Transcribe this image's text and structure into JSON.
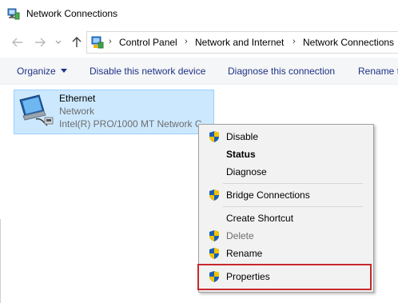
{
  "window": {
    "title": "Network Connections",
    "icon": "network-connections-icon"
  },
  "nav": {
    "back_icon": "back-arrow-icon",
    "forward_icon": "forward-arrow-icon",
    "up_icon": "up-arrow-icon"
  },
  "address": {
    "icon": "control-panel-icon",
    "breadcrumbs": [
      "Control Panel",
      "Network and Internet",
      "Network Connections"
    ],
    "separator": "›"
  },
  "commandbar": {
    "organize": "Organize",
    "disable": "Disable this network device",
    "diagnose": "Diagnose this connection",
    "rename": "Rename t"
  },
  "connection": {
    "name": "Ethernet",
    "status": "Network",
    "device": "Intel(R) PRO/1000 MT Network C...",
    "icon": "ethernet-adapter-icon"
  },
  "context_menu": {
    "items": [
      {
        "label": "Disable",
        "icon": "uac-shield-icon",
        "bold": false,
        "disabled": false
      },
      {
        "label": "Status",
        "icon": "",
        "bold": true,
        "disabled": false
      },
      {
        "label": "Diagnose",
        "icon": "",
        "bold": false,
        "disabled": false
      },
      {
        "label": "Bridge Connections",
        "icon": "uac-shield-icon",
        "bold": false,
        "disabled": false
      },
      {
        "label": "Create Shortcut",
        "icon": "",
        "bold": false,
        "disabled": false
      },
      {
        "label": "Delete",
        "icon": "uac-shield-icon",
        "bold": false,
        "disabled": true
      },
      {
        "label": "Rename",
        "icon": "uac-shield-icon",
        "bold": false,
        "disabled": false
      },
      {
        "label": "Properties",
        "icon": "uac-shield-icon",
        "bold": false,
        "disabled": false
      }
    ]
  },
  "colors": {
    "selection_bg": "#cce8ff",
    "selection_border": "#99d1ff",
    "command_text": "#1e3287",
    "highlight_box": "#c8282d"
  }
}
